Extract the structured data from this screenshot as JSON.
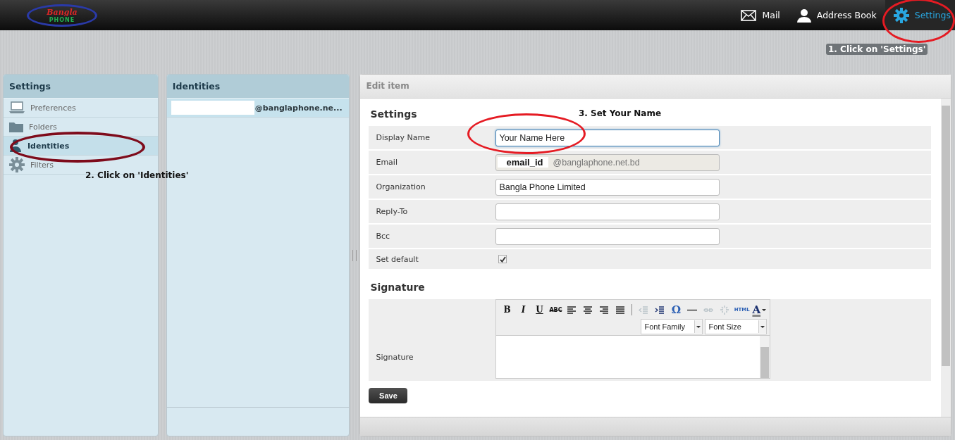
{
  "logo": {
    "word1": "Bangla",
    "word2": "PHONE"
  },
  "topnav": [
    {
      "label": "Mail",
      "kind": "mail",
      "selected": false
    },
    {
      "label": "Address Book",
      "kind": "person",
      "selected": false
    },
    {
      "label": "Settings",
      "kind": "gear",
      "selected": true
    }
  ],
  "sidebar": {
    "title": "Settings",
    "items": [
      {
        "label": "Preferences",
        "kind": "laptop",
        "selected": false
      },
      {
        "label": "Folders",
        "kind": "folder",
        "selected": false
      },
      {
        "label": "Identities",
        "kind": "identity",
        "selected": true
      },
      {
        "label": "Filters",
        "kind": "gear",
        "selected": false
      }
    ]
  },
  "identities": {
    "title": "Identities",
    "items": [
      {
        "label": "@banglaphone.ne...",
        "selected": true
      }
    ]
  },
  "edit": {
    "title": "Edit item",
    "section": "Settings",
    "fields": [
      {
        "kind": "text",
        "label": "Display Name",
        "value": "Your Name Here",
        "focused": true
      },
      {
        "kind": "email",
        "label": "Email",
        "user": "email_id",
        "domain": "@banglaphone.net.bd"
      },
      {
        "kind": "text",
        "label": "Organization",
        "value": "Bangla Phone Limited",
        "focused": false
      },
      {
        "kind": "text",
        "label": "Reply-To",
        "focused": false
      },
      {
        "kind": "text",
        "label": "Bcc",
        "focused": false
      },
      {
        "kind": "checkbox",
        "label": "Set default",
        "checked": true
      }
    ],
    "signature_title": "Signature",
    "signature_label": "Signature",
    "toolbar": [
      {
        "kind": "bold",
        "label": "B",
        "disabled": false
      },
      {
        "kind": "italic",
        "label": "I",
        "disabled": false
      },
      {
        "kind": "underline",
        "label": "U",
        "disabled": false
      },
      {
        "kind": "strike",
        "label": "ABC",
        "disabled": false
      },
      {
        "kind": "alignleft",
        "disabled": false
      },
      {
        "kind": "aligncenter",
        "disabled": false
      },
      {
        "kind": "alignright",
        "disabled": false
      },
      {
        "kind": "justify",
        "disabled": false
      },
      {
        "kind": "separator"
      },
      {
        "kind": "outdent",
        "disabled": true
      },
      {
        "kind": "indent",
        "disabled": false
      },
      {
        "kind": "omega",
        "label": "Ω",
        "disabled": false
      },
      {
        "kind": "rule",
        "disabled": false
      },
      {
        "kind": "link",
        "disabled": true
      },
      {
        "kind": "unlink",
        "disabled": true
      },
      {
        "kind": "html",
        "label": "HTML",
        "disabled": false
      },
      {
        "kind": "color",
        "label": "A",
        "disabled": false
      }
    ],
    "font_family": "Font Family",
    "font_size": "Font Size",
    "save": "Save"
  },
  "annotations": [
    {
      "text": "1. Click on 'Settings'"
    },
    {
      "text": "2. Click on 'Identities'"
    },
    {
      "text": "3. Set Your Name"
    }
  ]
}
